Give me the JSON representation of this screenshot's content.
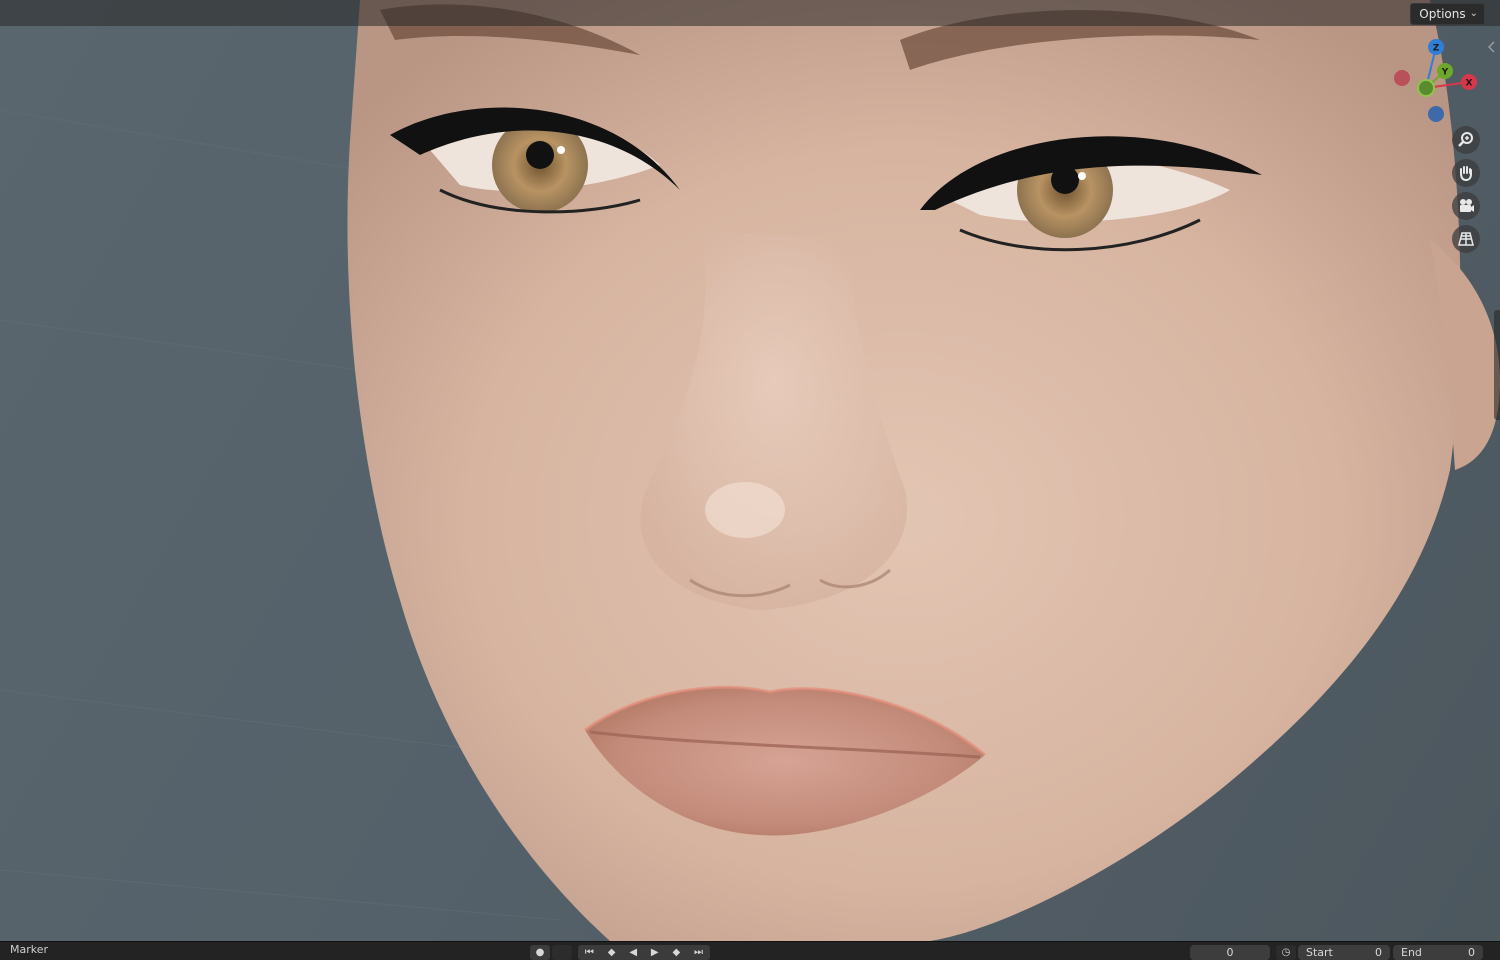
{
  "header": {
    "options_label": "Options"
  },
  "gizmo": {
    "axes": [
      {
        "label": "Z",
        "color": "#2f7fd8"
      },
      {
        "label": "Y",
        "color": "#6ea82a"
      },
      {
        "label": "X",
        "color": "#d8374a"
      }
    ],
    "negative_colors": {
      "x": "#b9505a",
      "y": "#5a8c2e",
      "z": "#3e6ba8"
    }
  },
  "nav_buttons": [
    {
      "icon": "zoom-icon"
    },
    {
      "icon": "hand-pan-icon"
    },
    {
      "icon": "camera-view-icon"
    },
    {
      "icon": "perspective-grid-icon"
    }
  ],
  "timeline": {
    "marker_label": "Marker",
    "current_frame": "0",
    "start_label": "Start",
    "start_value": "0",
    "end_label": "End",
    "end_value": "0"
  },
  "colors": {
    "background": "#56626a",
    "skin": "#d9b9a5",
    "lips": "#c98f7e",
    "iris": "#b08a55"
  }
}
